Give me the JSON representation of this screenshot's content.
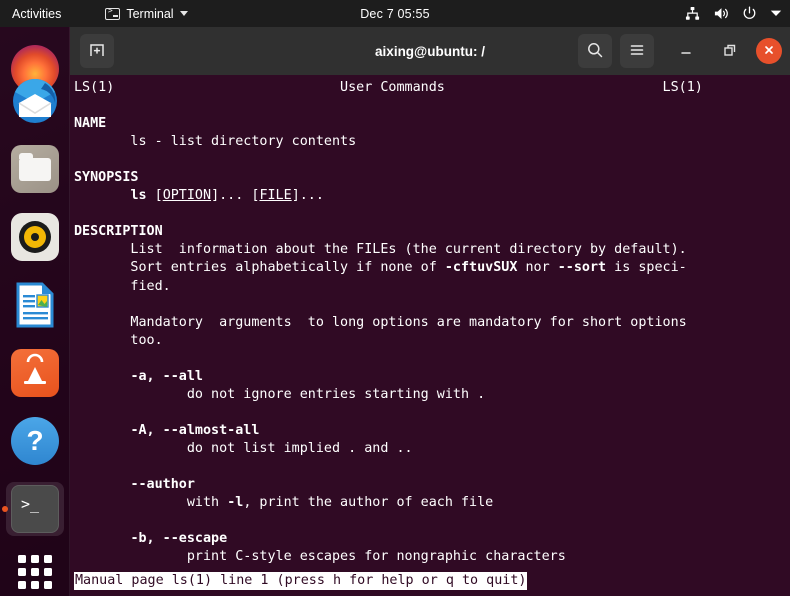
{
  "topbar": {
    "activities": "Activities",
    "app_menu": {
      "label": "Terminal",
      "icon": "terminal-icon"
    },
    "clock": "Dec 7  05:55",
    "tray": [
      {
        "name": "network-wired-icon"
      },
      {
        "name": "volume-icon"
      },
      {
        "name": "power-icon"
      },
      {
        "name": "chevron-down-icon"
      }
    ]
  },
  "dock": {
    "items": [
      {
        "name": "firefox",
        "label": "Firefox",
        "running": false
      },
      {
        "name": "thunderbird",
        "label": "Thunderbird Mail",
        "running": false
      },
      {
        "name": "files",
        "label": "Files",
        "running": false
      },
      {
        "name": "rhythmbox",
        "label": "Rhythmbox",
        "running": false
      },
      {
        "name": "libreoffice-writer",
        "label": "LibreOffice Writer",
        "running": false
      },
      {
        "name": "ubuntu-software",
        "label": "Ubuntu Software",
        "running": false
      },
      {
        "name": "help",
        "label": "Help",
        "running": false,
        "glyph": "?"
      },
      {
        "name": "terminal",
        "label": "Terminal",
        "running": true,
        "glyph": ">_"
      }
    ],
    "show_applications": "Show Applications"
  },
  "window": {
    "title": "aixing@ubuntu: /",
    "new_tab_label": "New Tab",
    "search_label": "Search",
    "menu_label": "Main Menu",
    "minimize_label": "Minimize",
    "maximize_label": "Restore",
    "close_label": "Close",
    "colors": {
      "titlebar": "#303030",
      "terminal_bg": "#300a24",
      "terminal_fg": "#ffffff",
      "close_button": "#e7502b",
      "accent": "#e95420"
    }
  },
  "terminal": {
    "man_header": {
      "left": "LS(1)",
      "center": "User Commands",
      "right": "LS(1)"
    },
    "sections": [
      {
        "heading": "NAME",
        "lines": [
          "       ls - list directory contents"
        ]
      },
      {
        "heading": "SYNOPSIS",
        "lines": [
          "       ls [OPTION]... [FILE]..."
        ]
      },
      {
        "heading": "DESCRIPTION",
        "lines": [
          "       List  information about the FILEs (the current directory by default).",
          "       Sort entries alphabetically if none of -cftuvSUX nor --sort is speci-",
          "       fied.",
          "",
          "       Mandatory  arguments  to long options are mandatory for short options",
          "       too.",
          "",
          "       -a, --all",
          "              do not ignore entries starting with .",
          "",
          "       -A, --almost-all",
          "              do not list implied . and ..",
          "",
          "       --author",
          "              with -l, print the author of each file",
          "",
          "       -b, --escape",
          "              print C-style escapes for nongraphic characters"
        ]
      }
    ],
    "raw_text": "LS(1)                            User Commands                           LS(1)\n\nNAME\n       ls - list directory contents\n\nSYNOPSIS\n       ls [OPTION]... [FILE]...\n\nDESCRIPTION\n       List  information about the FILEs (the current directory by default).\n       Sort entries alphabetically if none of -cftuvSUX nor --sort is speci-\n       fied.\n\n       Mandatory  arguments  to long options are mandatory for short options\n       too.\n\n       -a, --all\n              do not ignore entries starting with .\n\n       -A, --almost-all\n              do not list implied . and ..\n\n       --author\n              with -l, print the author of each file\n\n       -b, --escape\n              print C-style escapes for nongraphic characters",
    "status_line": "Manual page ls(1) line 1 (press h for help or q to quit)"
  }
}
